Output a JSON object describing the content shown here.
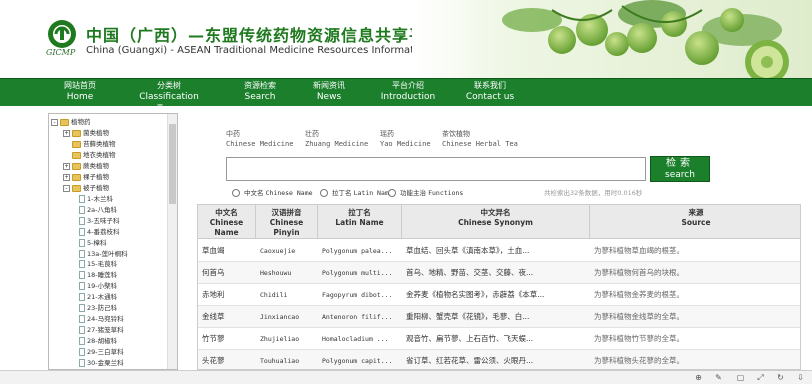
{
  "header": {
    "logo_caption": "GICMP",
    "title_cn": "中国（广西）—东盟传统药物资源信息共享平台",
    "title_en": "China (Guangxi) - ASEAN Traditional Medicine Resources Information System"
  },
  "nav": [
    {
      "cn": "网站首页",
      "en": "Home"
    },
    {
      "cn": "分类树",
      "en": "Classification Trees"
    },
    {
      "cn": "资源检索",
      "en": "Search"
    },
    {
      "cn": "新闻资讯",
      "en": "News"
    },
    {
      "cn": "平台介绍",
      "en": "Introduction"
    },
    {
      "cn": "联系我们",
      "en": "Contact us"
    }
  ],
  "tree": {
    "root": "植物药",
    "groups": [
      {
        "toggle": "+",
        "label": "菌类植物"
      },
      {
        "toggle": "",
        "label": "苔藓类植物"
      },
      {
        "toggle": "",
        "label": "地衣类植物"
      },
      {
        "toggle": "+",
        "label": "蕨类植物"
      },
      {
        "toggle": "+",
        "label": "裸子植物"
      },
      {
        "toggle": "-",
        "label": "被子植物"
      }
    ],
    "families": [
      "1-木兰科",
      "2a-八角科",
      "3-五味子科",
      "4-番荔枝科",
      "5-樟科",
      "13a-莲叶桐科",
      "15-毛茛科",
      "18-睡莲科",
      "19-小檗科",
      "21-木通科",
      "23-防己科",
      "24-马兜铃科",
      "27-猪笼草科",
      "28-胡椒科",
      "29-三白草科",
      "30-金粟兰科"
    ]
  },
  "categories": [
    {
      "cn": "中药",
      "en": "Chinese Medicine"
    },
    {
      "cn": "壮药",
      "en": "Zhuang Medicine"
    },
    {
      "cn": "瑶药",
      "en": "Yao Medicine"
    },
    {
      "cn": "茶饮植物",
      "en": "Chinese Herbal Tea"
    }
  ],
  "search": {
    "value": "",
    "placeholder": "",
    "button_cn": "检索",
    "button_en": "search"
  },
  "search_options": [
    {
      "cn": "中文名",
      "en": "Chinese Name",
      "selected": false
    },
    {
      "cn": "拉丁名",
      "en": "Latin Name",
      "selected": false
    },
    {
      "cn": "功能主治",
      "en": "Functions",
      "selected": false
    }
  ],
  "stats": "共检索出32条数据，用时0.016秒",
  "table": {
    "headers": [
      {
        "cn": "中文名",
        "en1": "Chinese",
        "en2": "Name"
      },
      {
        "cn": "汉语拼音",
        "en1": "Chinese",
        "en2": "Pinyin"
      },
      {
        "cn": "拉丁名",
        "en1": "Latin Name",
        "en2": ""
      },
      {
        "cn": "中文异名",
        "en1": "Chinese Synonym",
        "en2": ""
      },
      {
        "cn": "来源",
        "en1": "Source",
        "en2": ""
      }
    ],
    "rows": [
      {
        "name": "草血竭",
        "pinyin": "Caoxuejie",
        "latin": "Polygonum palea...",
        "synonym": "草血结、回头草《滇南本草》，土血...",
        "source": "为蓼科植物草血竭的根茎。"
      },
      {
        "name": "何首乌",
        "pinyin": "Heshouwu",
        "latin": "Polygonum multi...",
        "synonym": "首乌、地精、野苗、交茎、交藤、夜...",
        "source": "为蓼科植物何首乌的块根。"
      },
      {
        "name": "赤地利",
        "pinyin": "Chidili",
        "latin": "Fagopyrum dibot...",
        "synonym": "金荞麦《植物名实图考》，赤薜荔《本草...",
        "source": "为蓼科植物金荞麦的根茎。"
      },
      {
        "name": "金线草",
        "pinyin": "Jinxiancao",
        "latin": "Antenoron filif...",
        "synonym": "重阳柳、蟹壳草《花镜》，毛蓼、白...",
        "source": "为蓼科植物金线草的全草。"
      },
      {
        "name": "竹节蓼",
        "pinyin": "Zhujieliao",
        "latin": "Homalocladium ...",
        "synonym": "观音竹、扁节蓼、上石百竹、飞天蜈...",
        "source": "为蓼科植物竹节蓼的全草。"
      },
      {
        "name": "头花蓼",
        "pinyin": "Touhualiao",
        "latin": "Polygonum capit...",
        "synonym": "省订草、红若花草、雷公须、火眼丹...",
        "source": "为蓼科植物头花蓼的全草。"
      }
    ]
  },
  "colors": {
    "nav_green": "#1b7f2c",
    "title_green": "#1f7a1f"
  }
}
